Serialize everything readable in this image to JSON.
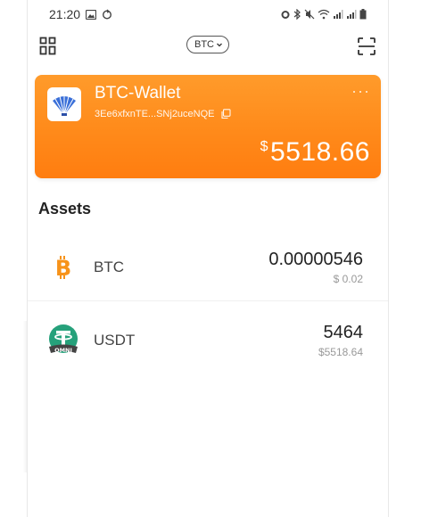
{
  "status_bar": {
    "time": "21:20"
  },
  "toolbar": {
    "coin_selector": "BTC"
  },
  "wallet": {
    "name": "BTC-Wallet",
    "address": "3Ee6xfxnTE...SNj2uceNQE",
    "more": "···",
    "balance_currency": "$",
    "balance": "5518.66"
  },
  "assets": {
    "title": "Assets",
    "items": [
      {
        "symbol": "BTC",
        "icon": "bitcoin-icon",
        "amount": "0.00000546",
        "fiat": "$ 0.02"
      },
      {
        "symbol": "USDT",
        "icon": "tether-omni-icon",
        "amount": "5464",
        "fiat": "$5518.64",
        "icon_badge": "OMNI"
      }
    ]
  },
  "colors": {
    "card_orange": "#ff8a1a",
    "btc_orange": "#f7931a",
    "tether_green": "#26a17b"
  }
}
